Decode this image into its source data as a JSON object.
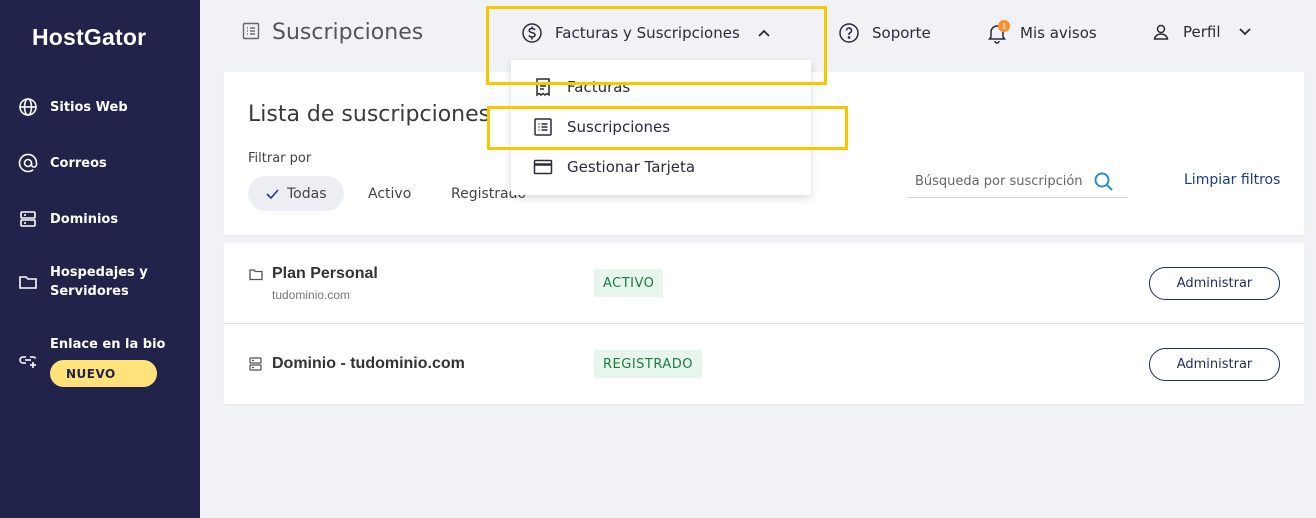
{
  "brand": {
    "logo": "HostGator"
  },
  "sidebar": {
    "items": [
      {
        "label": "Sitios Web",
        "icon": "globe-icon"
      },
      {
        "label": "Correos",
        "icon": "at-icon"
      },
      {
        "label": "Dominios",
        "icon": "server-icon"
      },
      {
        "label": "Hospedajes y",
        "label2": "Servidores",
        "icon": "folder-icon"
      },
      {
        "label": "Enlace en la bio",
        "icon": "link-icon",
        "badge": "NUEVO"
      }
    ]
  },
  "header": {
    "page_title": "Suscripciones",
    "nav": {
      "billing": "Facturas y Suscripciones",
      "support": "Soporte",
      "notifications": "Mis avisos",
      "notifications_count": "1",
      "profile": "Perfil"
    }
  },
  "dropdown": {
    "items": [
      {
        "label": "Facturas",
        "icon": "receipt-icon"
      },
      {
        "label": "Suscripciones",
        "icon": "list-icon"
      },
      {
        "label": "Gestionar Tarjeta",
        "icon": "credit-card-icon"
      }
    ]
  },
  "filters": {
    "title": "Lista de suscripciones",
    "label": "Filtrar por",
    "chips": [
      "Todas",
      "Activo",
      "Registrado"
    ],
    "search_placeholder": "Búsqueda por suscripción",
    "clear": "Limpiar filtros"
  },
  "subscriptions": [
    {
      "title": "Plan Personal",
      "subtitle": "tudominio.com",
      "status": "ACTIVO",
      "action": "Administrar",
      "icon": "folder-icon"
    },
    {
      "title": "Dominio - tudominio.com",
      "subtitle": "",
      "status": "REGISTRADO",
      "action": "Administrar",
      "icon": "server-icon"
    }
  ],
  "colors": {
    "sidebar_bg": "#22234a",
    "highlight": "#f5c800",
    "badge_new": "#ffe27a",
    "status_bg": "#e6f6ec",
    "status_text": "#1e7a43",
    "link": "#1f3a8a",
    "notif_dot": "#ff8c2f"
  }
}
